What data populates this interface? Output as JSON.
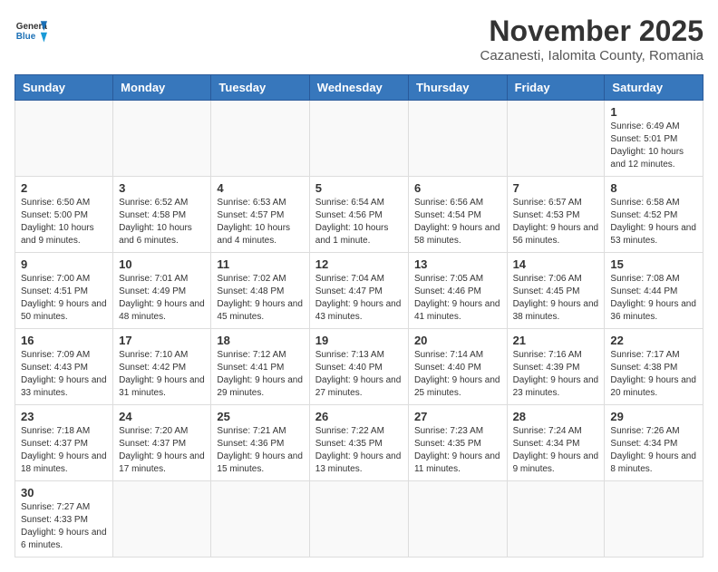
{
  "header": {
    "logo_general": "General",
    "logo_blue": "Blue",
    "month": "November 2025",
    "location": "Cazanesti, Ialomita County, Romania"
  },
  "days_of_week": [
    "Sunday",
    "Monday",
    "Tuesday",
    "Wednesday",
    "Thursday",
    "Friday",
    "Saturday"
  ],
  "weeks": [
    [
      {
        "day": "",
        "info": ""
      },
      {
        "day": "",
        "info": ""
      },
      {
        "day": "",
        "info": ""
      },
      {
        "day": "",
        "info": ""
      },
      {
        "day": "",
        "info": ""
      },
      {
        "day": "",
        "info": ""
      },
      {
        "day": "1",
        "info": "Sunrise: 6:49 AM\nSunset: 5:01 PM\nDaylight: 10 hours and 12 minutes."
      }
    ],
    [
      {
        "day": "2",
        "info": "Sunrise: 6:50 AM\nSunset: 5:00 PM\nDaylight: 10 hours and 9 minutes."
      },
      {
        "day": "3",
        "info": "Sunrise: 6:52 AM\nSunset: 4:58 PM\nDaylight: 10 hours and 6 minutes."
      },
      {
        "day": "4",
        "info": "Sunrise: 6:53 AM\nSunset: 4:57 PM\nDaylight: 10 hours and 4 minutes."
      },
      {
        "day": "5",
        "info": "Sunrise: 6:54 AM\nSunset: 4:56 PM\nDaylight: 10 hours and 1 minute."
      },
      {
        "day": "6",
        "info": "Sunrise: 6:56 AM\nSunset: 4:54 PM\nDaylight: 9 hours and 58 minutes."
      },
      {
        "day": "7",
        "info": "Sunrise: 6:57 AM\nSunset: 4:53 PM\nDaylight: 9 hours and 56 minutes."
      },
      {
        "day": "8",
        "info": "Sunrise: 6:58 AM\nSunset: 4:52 PM\nDaylight: 9 hours and 53 minutes."
      }
    ],
    [
      {
        "day": "9",
        "info": "Sunrise: 7:00 AM\nSunset: 4:51 PM\nDaylight: 9 hours and 50 minutes."
      },
      {
        "day": "10",
        "info": "Sunrise: 7:01 AM\nSunset: 4:49 PM\nDaylight: 9 hours and 48 minutes."
      },
      {
        "day": "11",
        "info": "Sunrise: 7:02 AM\nSunset: 4:48 PM\nDaylight: 9 hours and 45 minutes."
      },
      {
        "day": "12",
        "info": "Sunrise: 7:04 AM\nSunset: 4:47 PM\nDaylight: 9 hours and 43 minutes."
      },
      {
        "day": "13",
        "info": "Sunrise: 7:05 AM\nSunset: 4:46 PM\nDaylight: 9 hours and 41 minutes."
      },
      {
        "day": "14",
        "info": "Sunrise: 7:06 AM\nSunset: 4:45 PM\nDaylight: 9 hours and 38 minutes."
      },
      {
        "day": "15",
        "info": "Sunrise: 7:08 AM\nSunset: 4:44 PM\nDaylight: 9 hours and 36 minutes."
      }
    ],
    [
      {
        "day": "16",
        "info": "Sunrise: 7:09 AM\nSunset: 4:43 PM\nDaylight: 9 hours and 33 minutes."
      },
      {
        "day": "17",
        "info": "Sunrise: 7:10 AM\nSunset: 4:42 PM\nDaylight: 9 hours and 31 minutes."
      },
      {
        "day": "18",
        "info": "Sunrise: 7:12 AM\nSunset: 4:41 PM\nDaylight: 9 hours and 29 minutes."
      },
      {
        "day": "19",
        "info": "Sunrise: 7:13 AM\nSunset: 4:40 PM\nDaylight: 9 hours and 27 minutes."
      },
      {
        "day": "20",
        "info": "Sunrise: 7:14 AM\nSunset: 4:40 PM\nDaylight: 9 hours and 25 minutes."
      },
      {
        "day": "21",
        "info": "Sunrise: 7:16 AM\nSunset: 4:39 PM\nDaylight: 9 hours and 23 minutes."
      },
      {
        "day": "22",
        "info": "Sunrise: 7:17 AM\nSunset: 4:38 PM\nDaylight: 9 hours and 20 minutes."
      }
    ],
    [
      {
        "day": "23",
        "info": "Sunrise: 7:18 AM\nSunset: 4:37 PM\nDaylight: 9 hours and 18 minutes."
      },
      {
        "day": "24",
        "info": "Sunrise: 7:20 AM\nSunset: 4:37 PM\nDaylight: 9 hours and 17 minutes."
      },
      {
        "day": "25",
        "info": "Sunrise: 7:21 AM\nSunset: 4:36 PM\nDaylight: 9 hours and 15 minutes."
      },
      {
        "day": "26",
        "info": "Sunrise: 7:22 AM\nSunset: 4:35 PM\nDaylight: 9 hours and 13 minutes."
      },
      {
        "day": "27",
        "info": "Sunrise: 7:23 AM\nSunset: 4:35 PM\nDaylight: 9 hours and 11 minutes."
      },
      {
        "day": "28",
        "info": "Sunrise: 7:24 AM\nSunset: 4:34 PM\nDaylight: 9 hours and 9 minutes."
      },
      {
        "day": "29",
        "info": "Sunrise: 7:26 AM\nSunset: 4:34 PM\nDaylight: 9 hours and 8 minutes."
      }
    ],
    [
      {
        "day": "30",
        "info": "Sunrise: 7:27 AM\nSunset: 4:33 PM\nDaylight: 9 hours and 6 minutes."
      },
      {
        "day": "",
        "info": ""
      },
      {
        "day": "",
        "info": ""
      },
      {
        "day": "",
        "info": ""
      },
      {
        "day": "",
        "info": ""
      },
      {
        "day": "",
        "info": ""
      },
      {
        "day": "",
        "info": ""
      }
    ]
  ]
}
